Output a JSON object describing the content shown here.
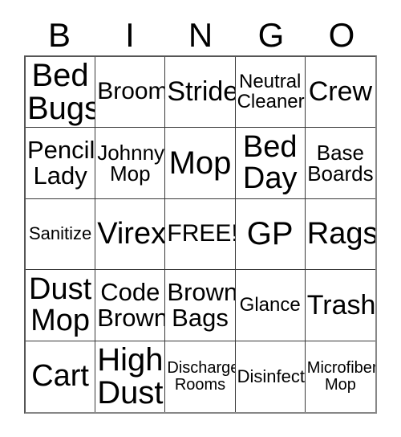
{
  "card": {
    "title": "BINGO",
    "header_letters": [
      "B",
      "I",
      "N",
      "G",
      "O"
    ],
    "free_space_label": "FREE!",
    "colors": {
      "background": "#ffffff",
      "text": "#000000",
      "grid_line": "#3a3a3a",
      "outer_border": "#555555"
    },
    "rows": [
      [
        {
          "text": "Bed\nBugs",
          "size": "fs-40"
        },
        {
          "text": "Broom",
          "size": "fs-30"
        },
        {
          "text": "Stride",
          "size": "fs-34"
        },
        {
          "text": "Neutral\nCleaner",
          "size": "fs-24"
        },
        {
          "text": "Crew",
          "size": "fs-34"
        }
      ],
      [
        {
          "text": "Pencil\nLady",
          "size": "fs-31"
        },
        {
          "text": "Johnny\nMop",
          "size": "fs-26"
        },
        {
          "text": "Mop",
          "size": "fs-40"
        },
        {
          "text": "Bed\nDay",
          "size": "fs-38"
        },
        {
          "text": "Base\nBoards",
          "size": "fs-26"
        }
      ],
      [
        {
          "text": "Sanitize",
          "size": "fs-22"
        },
        {
          "text": "Virex",
          "size": "fs-38"
        },
        {
          "text": "FREE!",
          "size": "fs-30"
        },
        {
          "text": "GP",
          "size": "fs-40"
        },
        {
          "text": "Rags",
          "size": "fs-38"
        }
      ],
      [
        {
          "text": "Dust\nMop",
          "size": "fs-38"
        },
        {
          "text": "Code\nBrown",
          "size": "fs-31"
        },
        {
          "text": "Brown\nBags",
          "size": "fs-31"
        },
        {
          "text": "Glance",
          "size": "fs-24"
        },
        {
          "text": "Trash",
          "size": "fs-34"
        }
      ],
      [
        {
          "text": "Cart",
          "size": "fs-38"
        },
        {
          "text": "High\nDust",
          "size": "fs-40"
        },
        {
          "text": "Discharge\nRooms",
          "size": "fs-20"
        },
        {
          "text": "Disinfect",
          "size": "fs-22"
        },
        {
          "text": "Microfiber\nMop",
          "size": "fs-20"
        }
      ]
    ]
  }
}
